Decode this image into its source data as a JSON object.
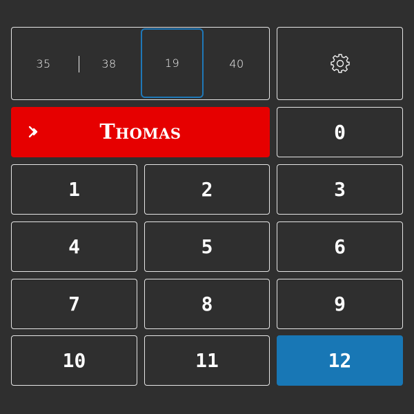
{
  "scores": [
    {
      "label": "35",
      "selected": false
    },
    {
      "label": "38",
      "selected": false
    },
    {
      "label": "19",
      "selected": true
    },
    {
      "label": "40",
      "selected": false
    }
  ],
  "settings": {
    "icon": "gear-icon"
  },
  "player": {
    "name": "Thomas",
    "icon": "double-chevron-right-icon",
    "color": "#e60000"
  },
  "keypad": {
    "keys": [
      "0",
      "1",
      "2",
      "3",
      "4",
      "5",
      "6",
      "7",
      "8",
      "9",
      "10",
      "11",
      "12"
    ],
    "selected": "12",
    "accent": "#1877b5"
  },
  "colors": {
    "background": "#2f2f2f",
    "border": "#e6e6e6",
    "selected_outline": "#1f78b8"
  }
}
